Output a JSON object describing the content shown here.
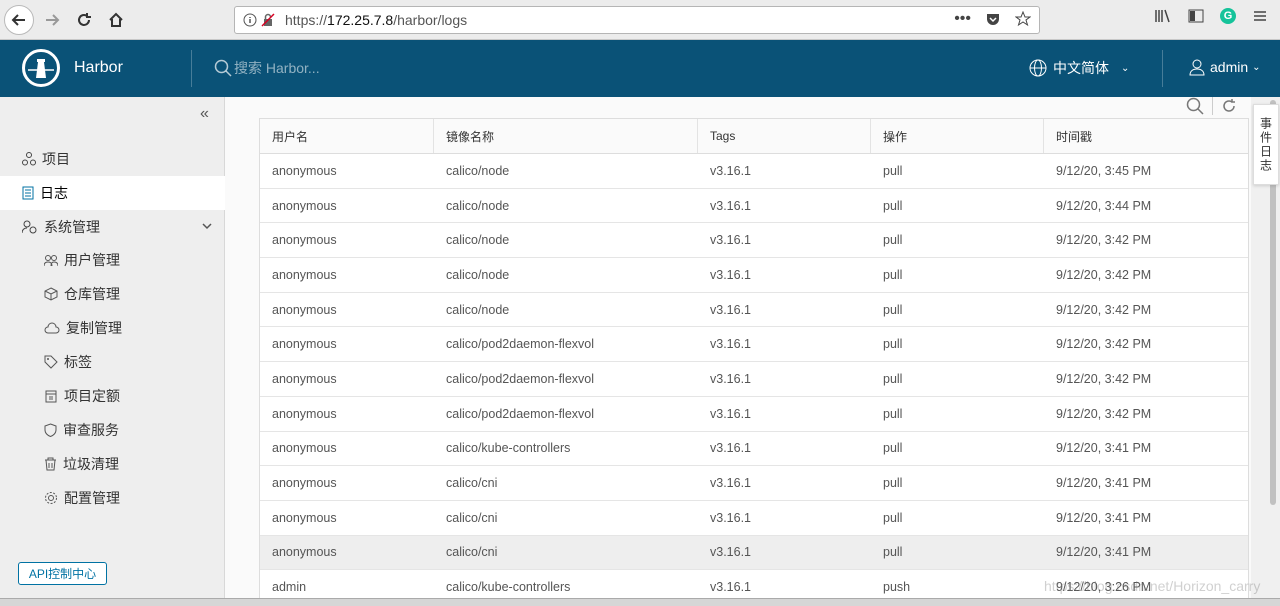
{
  "browser": {
    "url_prefix": "https://",
    "url_host": "172.25.7.8",
    "url_path": "/harbor/logs",
    "more_icon": "ellipsis-icon",
    "grammarly_letter": "G"
  },
  "header": {
    "brand": "Harbor",
    "search_placeholder": "搜索 Harbor...",
    "language": "中文简体",
    "user": "admin"
  },
  "sidebar": {
    "collapse_glyph": "«",
    "items": [
      {
        "label": "项目",
        "icon": "projects-icon"
      },
      {
        "label": "日志",
        "icon": "logs-icon"
      },
      {
        "label": "系统管理",
        "icon": "system-admin-icon"
      }
    ],
    "sub_items": [
      {
        "label": "用户管理"
      },
      {
        "label": "仓库管理"
      },
      {
        "label": "复制管理"
      },
      {
        "label": "标签"
      },
      {
        "label": "项目定额"
      },
      {
        "label": "审查服务"
      },
      {
        "label": "垃圾清理"
      },
      {
        "label": "配置管理"
      }
    ],
    "api_button": "API控制中心"
  },
  "side_tab": "事件日志",
  "table": {
    "columns": [
      "用户名",
      "镜像名称",
      "Tags",
      "操作",
      "时间戳"
    ],
    "rows": [
      [
        "anonymous",
        "calico/node",
        "v3.16.1",
        "pull",
        "9/12/20, 3:45 PM"
      ],
      [
        "anonymous",
        "calico/node",
        "v3.16.1",
        "pull",
        "9/12/20, 3:44 PM"
      ],
      [
        "anonymous",
        "calico/node",
        "v3.16.1",
        "pull",
        "9/12/20, 3:42 PM"
      ],
      [
        "anonymous",
        "calico/node",
        "v3.16.1",
        "pull",
        "9/12/20, 3:42 PM"
      ],
      [
        "anonymous",
        "calico/node",
        "v3.16.1",
        "pull",
        "9/12/20, 3:42 PM"
      ],
      [
        "anonymous",
        "calico/pod2daemon-flexvol",
        "v3.16.1",
        "pull",
        "9/12/20, 3:42 PM"
      ],
      [
        "anonymous",
        "calico/pod2daemon-flexvol",
        "v3.16.1",
        "pull",
        "9/12/20, 3:42 PM"
      ],
      [
        "anonymous",
        "calico/pod2daemon-flexvol",
        "v3.16.1",
        "pull",
        "9/12/20, 3:42 PM"
      ],
      [
        "anonymous",
        "calico/kube-controllers",
        "v3.16.1",
        "pull",
        "9/12/20, 3:41 PM"
      ],
      [
        "anonymous",
        "calico/cni",
        "v3.16.1",
        "pull",
        "9/12/20, 3:41 PM"
      ],
      [
        "anonymous",
        "calico/cni",
        "v3.16.1",
        "pull",
        "9/12/20, 3:41 PM"
      ],
      [
        "anonymous",
        "calico/cni",
        "v3.16.1",
        "pull",
        "9/12/20, 3:41 PM"
      ],
      [
        "admin",
        "calico/kube-controllers",
        "v3.16.1",
        "push",
        "9/12/20, 3:26 PM"
      ]
    ],
    "highlighted_row": 11
  },
  "watermark": "https://blog.csdn.net/Horizon_carry"
}
